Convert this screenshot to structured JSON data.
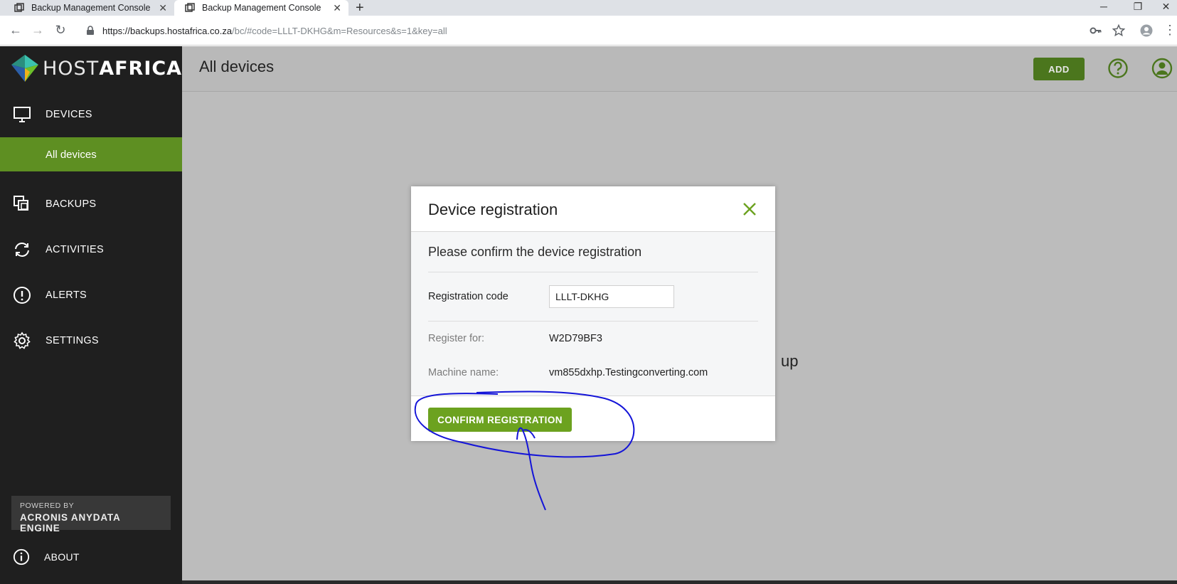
{
  "browser": {
    "tabs": [
      {
        "title": "Backup Management Console",
        "active": false
      },
      {
        "title": "Backup Management Console",
        "active": true
      }
    ],
    "url_host": "https://backups.hostafrica.co.za",
    "url_path": "/bc/#code=LLLT-DKHG&m=Resources&s=1&key=all"
  },
  "brand": {
    "logo_light": "HOST",
    "logo_bold": "AFRICA",
    "accent_color": "#6ca21f",
    "active_nav_color": "#5e8f22"
  },
  "sidebar": {
    "items": [
      {
        "label": "DEVICES",
        "icon": "monitor-icon"
      },
      {
        "label": "BACKUPS",
        "icon": "copy-icon"
      },
      {
        "label": "ACTIVITIES",
        "icon": "sync-icon"
      },
      {
        "label": "ALERTS",
        "icon": "alert-icon"
      },
      {
        "label": "SETTINGS",
        "icon": "gear-icon"
      }
    ],
    "sub_item": "All devices",
    "powered_by": "POWERED BY",
    "engine": "ACRONIS ANYDATA ENGINE",
    "about": "ABOUT"
  },
  "header": {
    "title": "All devices",
    "add_label": "ADD"
  },
  "background_text": "up",
  "modal": {
    "title": "Device registration",
    "message": "Please confirm the device registration",
    "registration_code_label": "Registration code",
    "registration_code_value": "LLLT-DKHG",
    "register_for_label": "Register for:",
    "register_for_value": "W2D79BF3",
    "machine_name_label": "Machine name:",
    "machine_name_value": "vm855dxhp.Testingconverting.com",
    "confirm_label": "CONFIRM REGISTRATION"
  },
  "annotation": {
    "color": "#1414d8",
    "type": "hand-drawn circle and arrow around confirm button"
  }
}
